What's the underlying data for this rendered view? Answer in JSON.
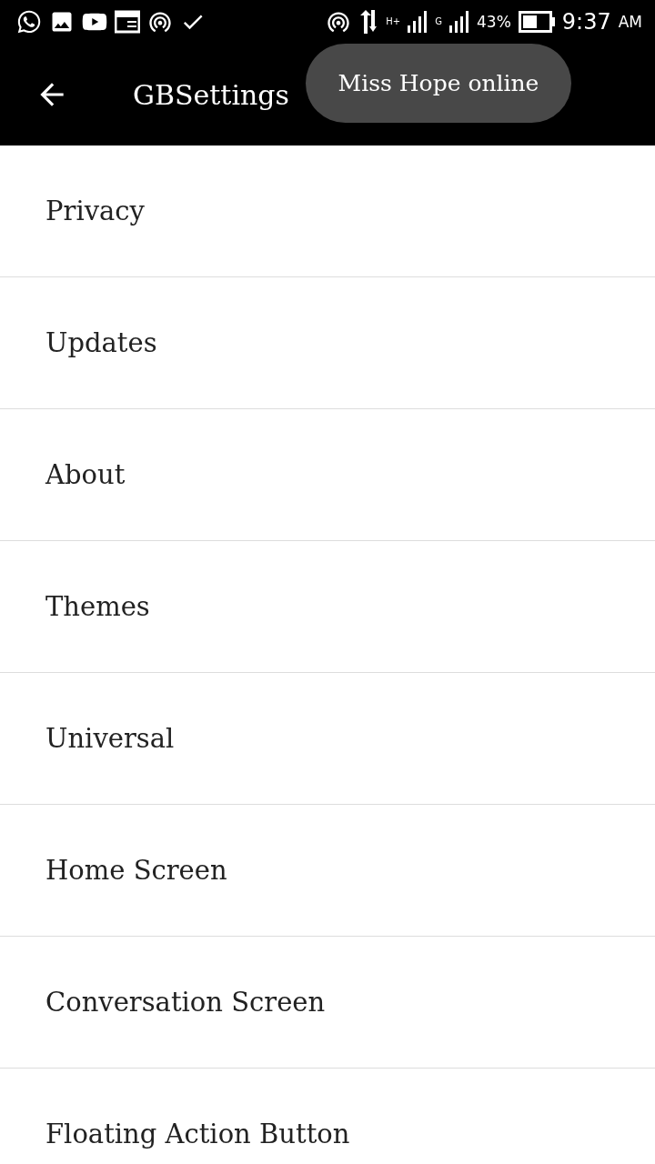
{
  "status_bar": {
    "network_labels": [
      "H+",
      "G"
    ],
    "battery": "43%",
    "time": "9:37",
    "meridiem": "AM"
  },
  "app_bar": {
    "title": "GBSettings"
  },
  "toast": {
    "text": "Miss Hope online"
  },
  "settings_items": [
    {
      "label": "Privacy"
    },
    {
      "label": "Updates"
    },
    {
      "label": "About"
    },
    {
      "label": "Themes"
    },
    {
      "label": "Universal"
    },
    {
      "label": "Home Screen"
    },
    {
      "label": "Conversation Screen"
    },
    {
      "label": "Floating Action Button"
    }
  ]
}
